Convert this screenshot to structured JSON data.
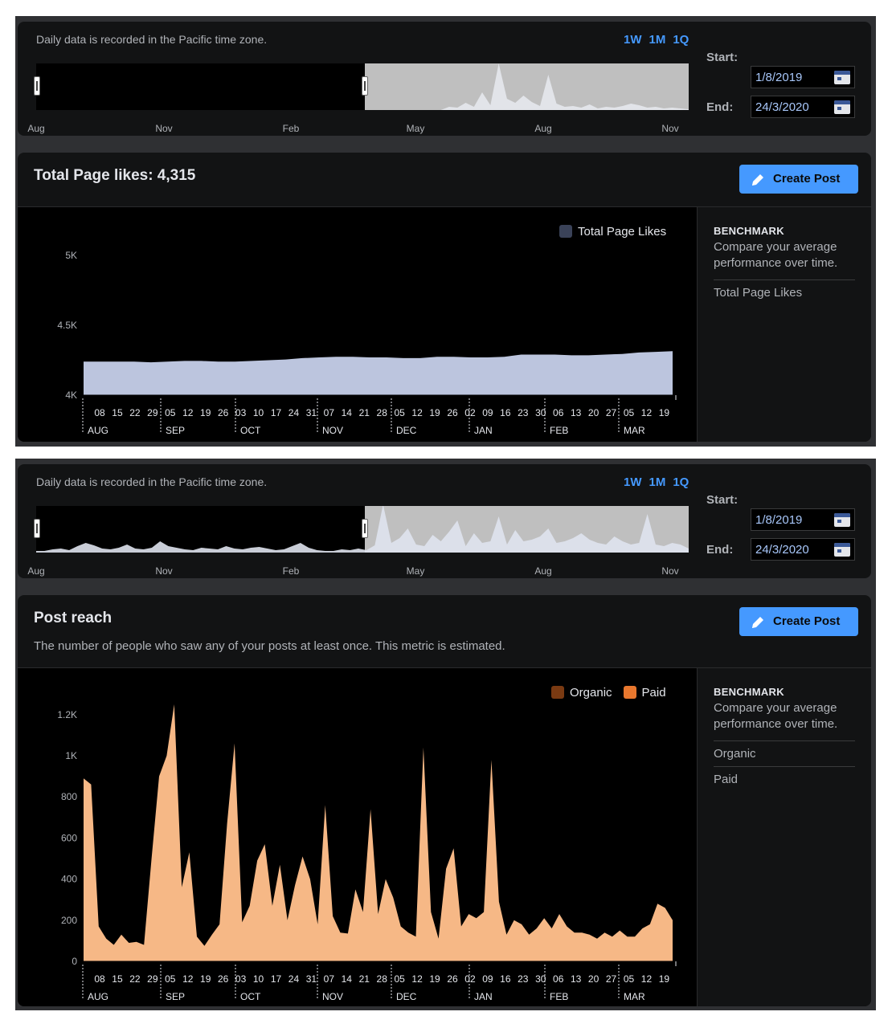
{
  "range_bar": {
    "timezone_note": "Daily data is recorded in the Pacific time zone.",
    "presets": [
      "1W",
      "1M",
      "1Q"
    ],
    "axis_labels": [
      "Aug",
      "Nov",
      "Feb",
      "May",
      "Aug",
      "Nov"
    ],
    "start_label": "Start:",
    "end_label": "End:",
    "start_value": "1/8/2019",
    "end_value": "24/3/2020"
  },
  "page_likes": {
    "title": "Total Page likes: 4,315",
    "create_post_label": "Create Post",
    "legend": "Total Page Likes",
    "color": "#bcc5de",
    "benchmark": {
      "heading": "BENCHMARK",
      "description": "Compare your average performance over time.",
      "items": [
        "Total Page Likes"
      ]
    }
  },
  "post_reach": {
    "title": "Post reach",
    "description": "The number of people who saw any of your posts at least once. This metric is estimated.",
    "create_post_label": "Create Post",
    "legend": [
      {
        "name": "Organic",
        "color": "#7a3a12"
      },
      {
        "name": "Paid",
        "color": "#e8772e"
      }
    ],
    "area_color": "#f6b886",
    "benchmark": {
      "heading": "BENCHMARK",
      "description": "Compare your average performance over time.",
      "items": [
        "Organic",
        "Paid"
      ]
    }
  },
  "chart_data": [
    {
      "type": "area",
      "title": "Total Page likes: 4,315",
      "series": [
        {
          "name": "Total Page Likes",
          "values": [
            4240,
            4240,
            4240,
            4240,
            4235,
            4240,
            4245,
            4245,
            4240,
            4240,
            4245,
            4250,
            4255,
            4265,
            4270,
            4275,
            4275,
            4270,
            4270,
            4265,
            4265,
            4275,
            4275,
            4270,
            4270,
            4275,
            4290,
            4290,
            4290,
            4285,
            4285,
            4290,
            4295,
            4305,
            4310,
            4315
          ]
        }
      ],
      "x_start": "2019-08-01",
      "x_end": "2020-03-24",
      "x_tick_labels": [
        "08",
        "15",
        "22",
        "29",
        "05",
        "12",
        "19",
        "26",
        "03",
        "10",
        "17",
        "24",
        "31",
        "07",
        "14",
        "21",
        "28",
        "05",
        "12",
        "19",
        "26",
        "02",
        "09",
        "16",
        "23",
        "30",
        "06",
        "13",
        "20",
        "27",
        "05",
        "12",
        "19"
      ],
      "x_month_labels": [
        "AUG",
        "SEP",
        "OCT",
        "NOV",
        "DEC",
        "JAN",
        "FEB",
        "MAR"
      ],
      "y_tick_labels": [
        "4K",
        "4.5K",
        "5K"
      ],
      "ylim": [
        4000,
        5000
      ]
    },
    {
      "type": "area",
      "title": "Post reach",
      "series": [
        {
          "name": "Paid",
          "values": [
            890,
            860,
            170,
            110,
            80,
            130,
            90,
            95,
            80,
            500,
            900,
            1000,
            1250,
            360,
            530,
            120,
            75,
            130,
            180,
            670,
            1060,
            190,
            270,
            490,
            570,
            270,
            470,
            200,
            370,
            510,
            400,
            180,
            760,
            220,
            140,
            135,
            350,
            240,
            740,
            230,
            400,
            310,
            170,
            140,
            120,
            1040,
            240,
            110,
            450,
            550,
            170,
            230,
            210,
            240,
            980,
            290,
            130,
            200,
            180,
            130,
            160,
            210,
            160,
            230,
            170,
            140,
            140,
            130,
            110,
            140,
            120,
            150,
            120,
            120,
            160,
            180,
            280,
            260,
            200
          ]
        },
        {
          "name": "Organic",
          "values": []
        }
      ],
      "x_start": "2019-08-01",
      "x_end": "2020-03-24",
      "x_tick_labels": [
        "08",
        "15",
        "22",
        "29",
        "05",
        "12",
        "19",
        "26",
        "03",
        "10",
        "17",
        "24",
        "31",
        "07",
        "14",
        "21",
        "28",
        "05",
        "12",
        "19",
        "26",
        "02",
        "09",
        "16",
        "23",
        "30",
        "06",
        "13",
        "20",
        "27",
        "05",
        "12",
        "19"
      ],
      "x_month_labels": [
        "AUG",
        "SEP",
        "OCT",
        "NOV",
        "DEC",
        "JAN",
        "FEB",
        "MAR"
      ],
      "y_tick_labels": [
        "0",
        "200",
        "400",
        "600",
        "800",
        "1K",
        "1.2K"
      ],
      "ylim": [
        0,
        1250
      ]
    }
  ],
  "mini_data": {
    "likes_overview": [
      0,
      0,
      0,
      0,
      0,
      0,
      0,
      0,
      0,
      0,
      0,
      0,
      0,
      0,
      0,
      0,
      0,
      0,
      0,
      0,
      0,
      0,
      0,
      0,
      0,
      0,
      0,
      0,
      0,
      0,
      0,
      0,
      0,
      0,
      0,
      0,
      0,
      0,
      0,
      0,
      0,
      0,
      0,
      0,
      0,
      0,
      0,
      0,
      0,
      0,
      4,
      3,
      9,
      4,
      22,
      6,
      58,
      14,
      9,
      18,
      10,
      5,
      44,
      8,
      4,
      5,
      3,
      7,
      2,
      4,
      3,
      5,
      8,
      6,
      3,
      4,
      2,
      3,
      2,
      1
    ],
    "reach_overview": [
      2,
      2,
      4,
      5,
      3,
      8,
      12,
      9,
      5,
      4,
      6,
      10,
      5,
      4,
      6,
      14,
      8,
      6,
      4,
      3,
      6,
      5,
      4,
      8,
      5,
      4,
      6,
      7,
      5,
      3,
      4,
      8,
      12,
      6,
      3,
      2,
      2,
      4,
      3,
      5,
      3,
      9,
      60,
      12,
      18,
      30,
      10,
      8,
      22,
      14,
      26,
      40,
      8,
      24,
      12,
      14,
      45,
      10,
      28,
      14,
      16,
      20,
      30,
      12,
      14,
      18,
      24,
      16,
      12,
      10,
      20,
      14,
      10,
      12,
      48,
      10,
      8,
      12,
      10,
      5
    ]
  }
}
